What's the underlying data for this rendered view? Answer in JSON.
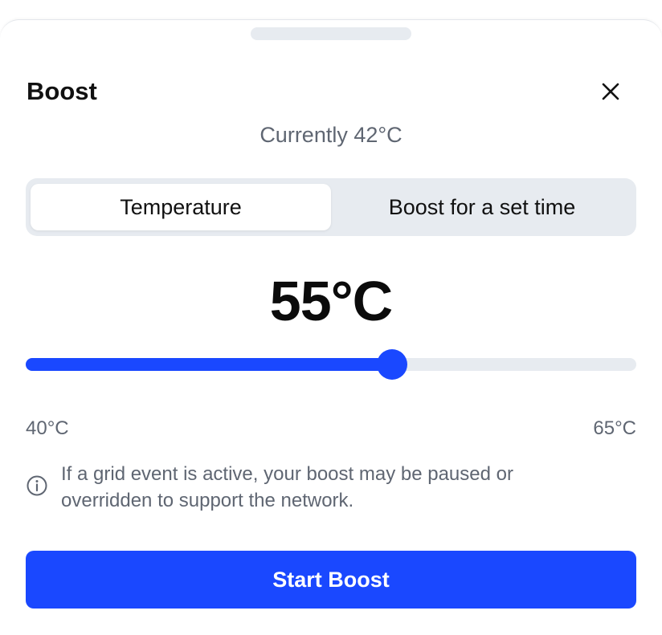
{
  "sheet": {
    "title": "Boost",
    "current_reading": "Currently 42°C"
  },
  "close": {
    "icon": "close-icon"
  },
  "mode_tabs": [
    {
      "label": "Temperature",
      "selected": true
    },
    {
      "label": "Boost for a set time",
      "selected": false
    }
  ],
  "target": {
    "display": "55°C",
    "value": 55,
    "min": 40,
    "max": 65,
    "min_label": "40°C",
    "max_label": "65°C"
  },
  "notice": {
    "icon": "info-icon",
    "text": "If a grid event is active, your boost may be paused or overridden to support the network."
  },
  "action": {
    "label": "Start Boost"
  },
  "colors": {
    "accent": "#1a48ff",
    "track": "#e7ebf0",
    "muted_text": "#5f6672"
  }
}
